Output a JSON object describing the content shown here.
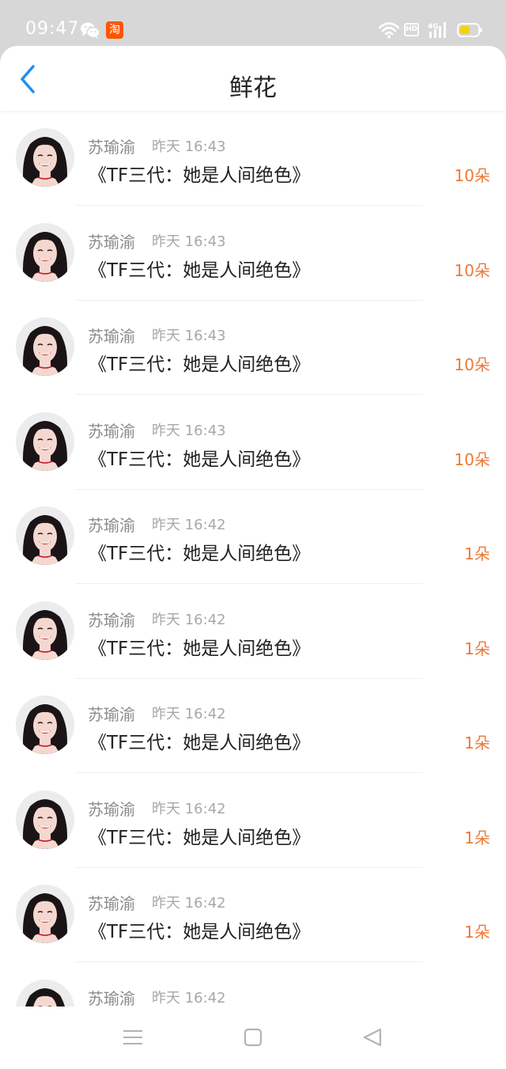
{
  "status_bar": {
    "time": "09:47",
    "taobao_label": "淘",
    "hd_label": "HD",
    "network_label": "4G"
  },
  "header": {
    "title": "鲜花",
    "accent_color": "#1e8ff0"
  },
  "gift_records": [
    {
      "name": "苏瑜渝",
      "time": "昨天 16:43",
      "book": "《TF三代：她是人间绝色》",
      "count": "10朵"
    },
    {
      "name": "苏瑜渝",
      "time": "昨天 16:43",
      "book": "《TF三代：她是人间绝色》",
      "count": "10朵"
    },
    {
      "name": "苏瑜渝",
      "time": "昨天 16:43",
      "book": "《TF三代：她是人间绝色》",
      "count": "10朵"
    },
    {
      "name": "苏瑜渝",
      "time": "昨天 16:43",
      "book": "《TF三代：她是人间绝色》",
      "count": "10朵"
    },
    {
      "name": "苏瑜渝",
      "time": "昨天 16:42",
      "book": "《TF三代：她是人间绝色》",
      "count": "1朵"
    },
    {
      "name": "苏瑜渝",
      "time": "昨天 16:42",
      "book": "《TF三代：她是人间绝色》",
      "count": "1朵"
    },
    {
      "name": "苏瑜渝",
      "time": "昨天 16:42",
      "book": "《TF三代：她是人间绝色》",
      "count": "1朵"
    },
    {
      "name": "苏瑜渝",
      "time": "昨天 16:42",
      "book": "《TF三代：她是人间绝色》",
      "count": "1朵"
    },
    {
      "name": "苏瑜渝",
      "time": "昨天 16:42",
      "book": "《TF三代：她是人间绝色》",
      "count": "1朵"
    },
    {
      "name": "苏瑜渝",
      "time": "昨天 16:42",
      "book": "",
      "count": ""
    }
  ],
  "colors": {
    "count": "#ec7a38",
    "name": "#8a8a8a",
    "time": "#a8a8a8",
    "status_bar": "#d7d7d7"
  },
  "icons": {
    "back": "chevron-left-icon",
    "wechat": "wechat-icon",
    "taobao": "taobao-icon",
    "wifi": "wifi-icon",
    "signal": "signal-icon",
    "battery": "battery-icon",
    "nav_menu": "menu-icon",
    "nav_home": "home-square-icon",
    "nav_back": "back-triangle-icon",
    "avatar": "avatar-photo"
  }
}
